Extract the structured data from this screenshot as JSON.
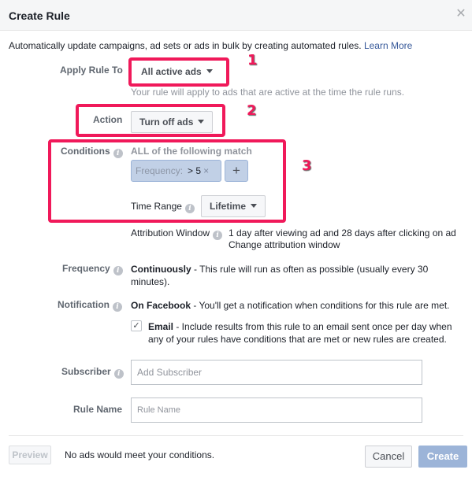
{
  "header": {
    "title": "Create Rule",
    "close_icon": "close-icon"
  },
  "intro": {
    "text": "Automatically update campaigns, ad sets or ads in bulk by creating automated rules.",
    "link": "Learn More"
  },
  "apply_rule_to": {
    "label": "Apply Rule To",
    "value": "All active ads",
    "hint": "Your rule will apply to ads that are active at the time the rule runs."
  },
  "action": {
    "label": "Action",
    "value": "Turn off ads"
  },
  "conditions": {
    "label": "Conditions",
    "match_text": "ALL of the following match",
    "chip": {
      "key": "Frequency:",
      "operator": ">",
      "value": "5",
      "remove_icon": "×"
    },
    "add_label": "+",
    "time_range_label": "Time Range",
    "time_range_value": "Lifetime"
  },
  "attribution": {
    "label": "Attribution Window",
    "text": "1 day after viewing ad and 28 days after clicking on ad",
    "link": "Change attribution window"
  },
  "frequency": {
    "label": "Frequency",
    "bold": "Continuously",
    "text": " - This rule will run as often as possible (usually every 30",
    "text2": "minutes)."
  },
  "notification": {
    "label": "Notification",
    "bold": "On Facebook",
    "text": " - You'll get a notification when conditions for this rule are met.",
    "email_checked": true,
    "email_bold": "Email",
    "email_text": " - Include results from this rule to an email sent once per day when",
    "email_text2": "any of your rules have conditions that are met or new rules are created."
  },
  "subscriber": {
    "label": "Subscriber",
    "placeholder": "Add Subscriber"
  },
  "rule_name": {
    "label": "Rule Name",
    "placeholder": "Rule Name"
  },
  "footer": {
    "preview": "Preview",
    "status": "No ads would meet your conditions.",
    "cancel": "Cancel",
    "create": "Create"
  },
  "annotations": {
    "one": "1",
    "two": "2",
    "three": "3",
    "color": "#f0195a"
  }
}
